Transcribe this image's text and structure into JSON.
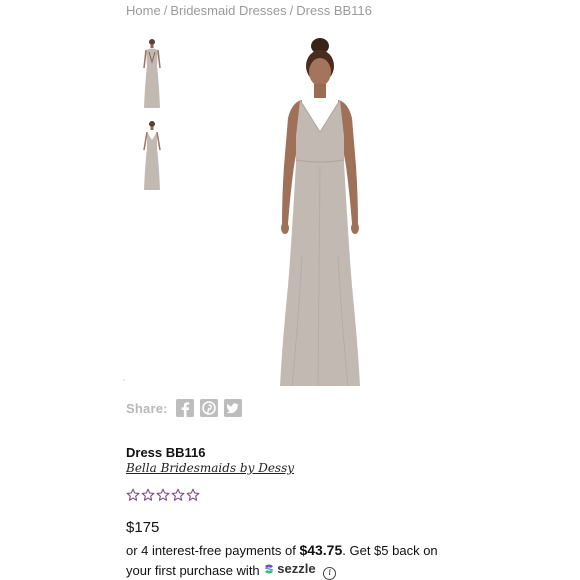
{
  "breadcrumb": {
    "items": [
      "Home",
      "Bridesmaid Dresses",
      "Dress BB116"
    ],
    "separator": "/"
  },
  "gallery": {
    "thumbnails": [
      {
        "view": "back"
      },
      {
        "view": "front"
      }
    ]
  },
  "share": {
    "label": "Share:",
    "icons": [
      "facebook-icon",
      "pinterest-icon",
      "twitter-icon"
    ]
  },
  "product": {
    "name": "Dress BB116",
    "designer": "Bella Bridesmaids by Dessy",
    "rating_stars": 5,
    "rating_filled": 0,
    "price": "$175"
  },
  "payments": {
    "prefix": "or 4 interest-free payments of",
    "amount": "$43.75",
    "suffix": ". Get $5 back on your first purchase with",
    "provider": "sezzle",
    "info_symbol": "i"
  },
  "colors": {
    "dress": "#c3b9b3",
    "star_outline": "#7a4a86",
    "breadcrumb_text": "#9a9a9a",
    "share_gray": "#bdbdbd"
  }
}
